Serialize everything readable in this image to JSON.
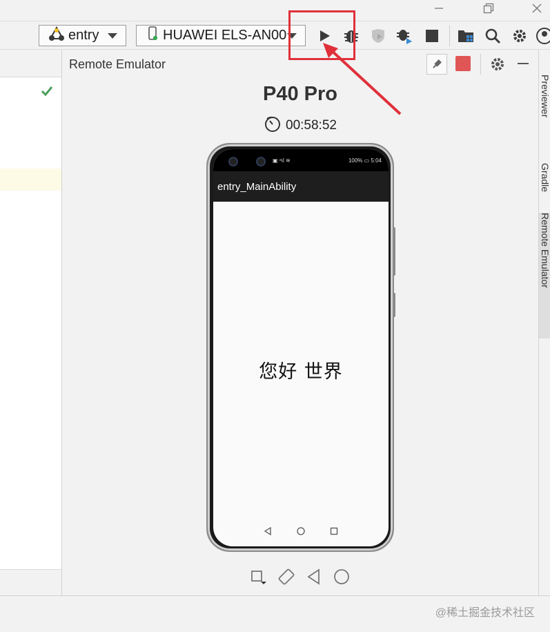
{
  "toolbar": {
    "module_label": "entry",
    "device_label": "HUAWEI ELS-AN00",
    "icons": [
      "run-icon",
      "debug-icon",
      "profile-icon",
      "attach-debugger-icon",
      "stop-icon",
      "project-structure-icon",
      "search-icon",
      "settings-icon"
    ]
  },
  "emulator": {
    "panel_title": "Remote Emulator",
    "device_name": "P40 Pro",
    "timer": "00:58:52",
    "phone": {
      "status_right": "100% ▭ 5:04",
      "app_title": "entry_MainAbility",
      "content_text": "您好 世界"
    }
  },
  "right_sidebar": {
    "tabs": [
      {
        "label": "Previewer"
      },
      {
        "label": "Gradle"
      },
      {
        "label": "Remote Emulator"
      }
    ]
  },
  "watermark": "@稀土掘金技术社区",
  "colors": {
    "highlight": "#e0303a",
    "stop_red": "#e05555",
    "check_green": "#4a9e5c"
  }
}
